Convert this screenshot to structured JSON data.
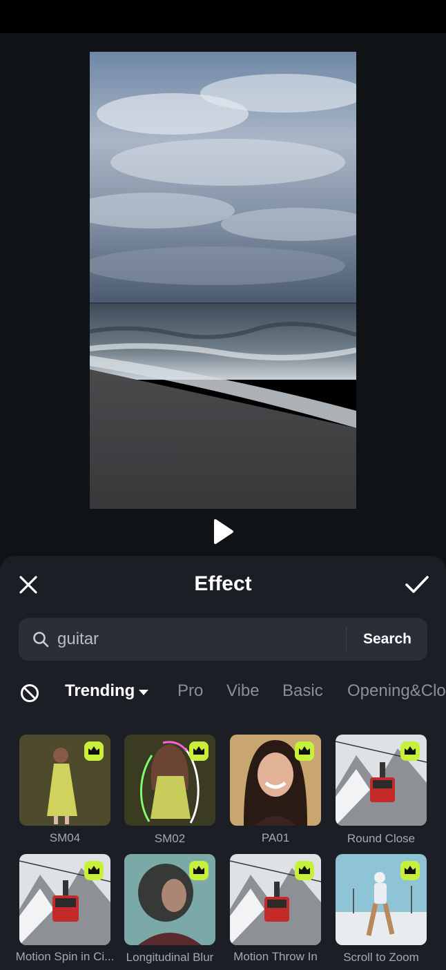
{
  "sheet": {
    "title": "Effect"
  },
  "search": {
    "query": "guitar",
    "button_label": "Search"
  },
  "tabs": [
    {
      "label": "Trending",
      "active": true
    },
    {
      "label": "Pro"
    },
    {
      "label": "Vibe"
    },
    {
      "label": "Basic"
    },
    {
      "label": "Opening&Closing"
    }
  ],
  "effects": [
    {
      "label": "SM04",
      "premium": true
    },
    {
      "label": "SM02",
      "premium": true
    },
    {
      "label": "PA01",
      "premium": true
    },
    {
      "label": "Round Close",
      "premium": true
    },
    {
      "label": "Motion Spin in Ci...",
      "premium": true
    },
    {
      "label": "Longitudinal Blur",
      "premium": true
    },
    {
      "label": "Motion Throw In",
      "premium": true
    },
    {
      "label": "Scroll to Zoom",
      "premium": true
    }
  ],
  "colors": {
    "premium_badge": "#c6f03a",
    "sheet_bg": "#1b1f25",
    "search_bg": "#2a2f37"
  },
  "icons": {
    "close": "close-icon",
    "confirm": "checkmark-icon",
    "search": "search-icon",
    "none": "no-effect-icon",
    "play": "play-icon",
    "premium": "crown-icon"
  }
}
